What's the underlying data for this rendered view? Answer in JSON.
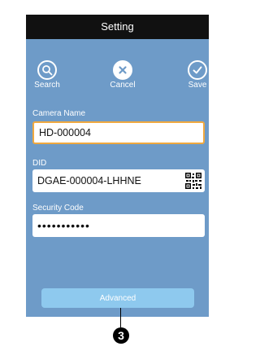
{
  "window": {
    "title": "Setting"
  },
  "actions": {
    "search_label": "Search",
    "cancel_label": "Cancel",
    "save_label": "Save"
  },
  "form": {
    "camera_name_label": "Camera Name",
    "camera_name_value": "HD-000004",
    "did_label": "DID",
    "did_value": "DGAE-000004-LHHNE",
    "security_code_label": "Security Code",
    "security_code_value": "•••••••••••"
  },
  "footer": {
    "advanced_label": "Advanced"
  },
  "callout": {
    "number": "3"
  },
  "colors": {
    "background": "#6e9bc8",
    "titlebar": "#111111",
    "focus_border": "#f0a940",
    "advanced_button": "#8ec9ee"
  },
  "icons": {
    "search": "search-icon",
    "cancel": "close-icon",
    "save": "checkmark-icon",
    "qr": "qr-code-icon"
  }
}
